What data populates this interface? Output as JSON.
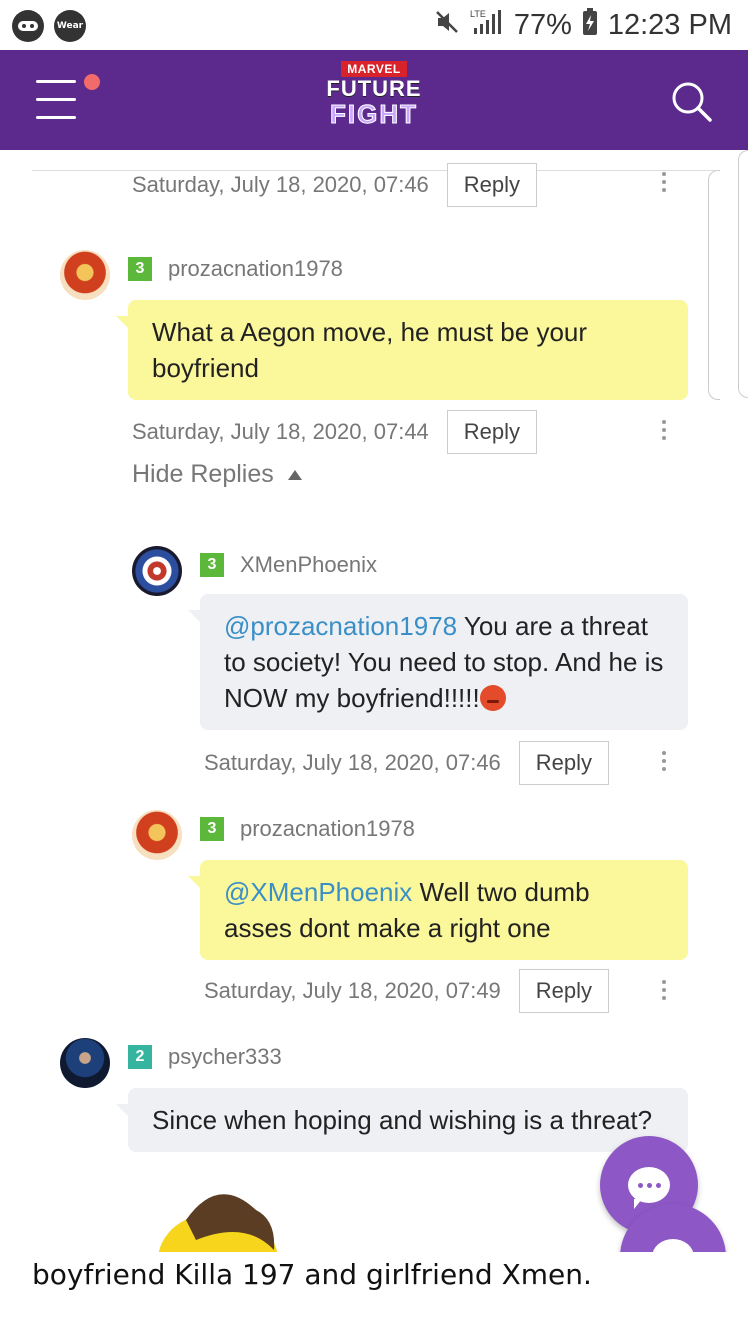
{
  "status_bar": {
    "left_badge_1": "",
    "left_badge_2": "Wear",
    "network": "LTE",
    "battery": "77%",
    "time": "12:23 PM"
  },
  "app_bar": {
    "logo_marvel": "MARVEL",
    "logo_line1": "FUTURE",
    "logo_line2": "FIGHT"
  },
  "comments": {
    "top_meta": {
      "date": "Saturday, July 18, 2020, 07:46",
      "reply": "Reply"
    },
    "c1": {
      "level": "3",
      "author": "prozacnation1978",
      "text": "What a Aegon move, he must be your boyfriend",
      "date": "Saturday, July 18, 2020, 07:44",
      "reply": "Reply"
    },
    "hide_replies": "Hide Replies",
    "r1": {
      "level": "3",
      "author": "XMenPhoenix",
      "mention": "@prozacnation1978",
      "text": " You are a threat to society! You need to stop. And he is NOW my boyfriend!!!!!",
      "date": "Saturday, July 18, 2020, 07:46",
      "reply": "Reply"
    },
    "r2": {
      "level": "3",
      "author": "prozacnation1978",
      "mention": "@XMenPhoenix",
      "text": " Well two dumb asses dont make a right one",
      "date": "Saturday, July 18, 2020, 07:49",
      "reply": "Reply"
    },
    "c2": {
      "level": "2",
      "author": "psycher333",
      "text": "Since when hoping and wishing is a threat?"
    }
  },
  "caption": "boyfriend Killa 197 and girlfriend Xmen.",
  "colors": {
    "app_bar": "#5b2a8c",
    "bubble_yellow": "#fbf79b",
    "bubble_gray": "#eef0f4",
    "mention": "#3a8fc7",
    "fab": "#8d58c5"
  },
  "icons": {
    "menu": "hamburger-menu-icon",
    "notification_dot": "notification-dot",
    "search": "search-icon",
    "more": "kebab-menu-icon",
    "chat": "chat-bubble-icon"
  }
}
